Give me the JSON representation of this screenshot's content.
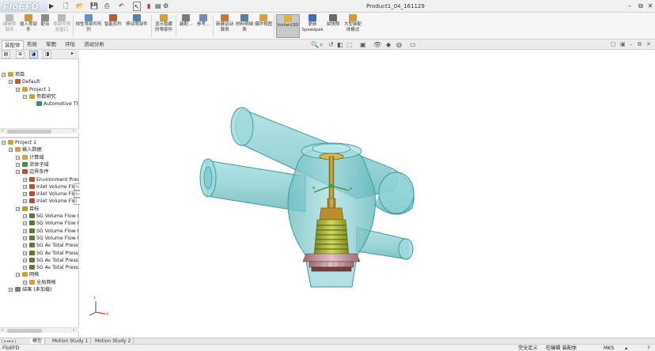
{
  "app": {
    "logo_text": "FloEFD",
    "document_title": "Product1_04_161129",
    "logo_arrow": "▶"
  },
  "window_controls": {
    "minimize": "–",
    "restore": "⧉",
    "close": "✕"
  },
  "ribbon": {
    "buttons": [
      {
        "label": "编辑零部件",
        "dim": true,
        "icon_color": "#b9b9b9"
      },
      {
        "label": "插入零部件",
        "dim": false,
        "icon_color": "#c9973f"
      },
      {
        "label": "配合",
        "dim": false,
        "icon_color": "#8c8c8c"
      },
      {
        "label": "零部件预览窗口",
        "dim": true,
        "icon_color": "#b9b9b9"
      },
      {
        "label": "线性零部件阵列",
        "dim": false,
        "icon_color": "#6a8fbf"
      },
      {
        "label": "智能扣件",
        "dim": false,
        "icon_color": "#a8643f"
      },
      {
        "label": "移动零部件",
        "dim": false,
        "icon_color": "#5f7fa8"
      },
      {
        "label": "显示隐藏的零部件",
        "dim": false,
        "icon_color": "#d0a040"
      },
      {
        "label": "装配...",
        "dim": false,
        "icon_color": "#7a7a7a"
      },
      {
        "label": "参考...",
        "dim": false,
        "icon_color": "#6b8fb5"
      },
      {
        "label": "新建运动算例",
        "dim": false,
        "icon_color": "#c27a3a"
      },
      {
        "label": "材料明细表",
        "dim": false,
        "icon_color": "#5c7da0"
      },
      {
        "label": "爆炸视图",
        "dim": false,
        "icon_color": "#d4a23d"
      },
      {
        "label": "Instant3D",
        "dim": false,
        "icon_color": "#e2b13c",
        "active": true
      },
      {
        "label": "更新 Speedpak",
        "dim": false,
        "icon_color": "#3f6fb0"
      },
      {
        "label": "拍快照",
        "dim": false,
        "icon_color": "#6a6a6a"
      },
      {
        "label": "大型装配体模式",
        "dim": false,
        "icon_color": "#d09a3a"
      }
    ]
  },
  "tabs": [
    "装配体",
    "布局",
    "草图",
    "评估",
    "流动分析"
  ],
  "active_tab": "装配体",
  "tree_top": {
    "items": [
      {
        "label": "项目",
        "indent": 0,
        "icon_color": "#d4a23d"
      },
      {
        "label": "Default",
        "indent": 1,
        "icon_color": "#c65a3a"
      },
      {
        "label": "Project 1",
        "indent": 2,
        "icon_color": "#d4a23d"
      },
      {
        "label": "参数研究",
        "indent": 3,
        "icon_color": "#d4a23d"
      },
      {
        "label": "Automotive Thermostat",
        "indent": 4,
        "icon_color": "#3f8f5a"
      }
    ]
  },
  "tree_bottom": {
    "items": [
      {
        "label": "Project 1",
        "indent": 0,
        "icon_color": "#d4a23d"
      },
      {
        "label": "输入数据",
        "indent": 1,
        "icon_color": "#d4a23d"
      },
      {
        "label": "计算域",
        "indent": 2,
        "icon_color": "#d4a23d"
      },
      {
        "label": "流体子域",
        "indent": 2,
        "icon_color": "#3f8f5a"
      },
      {
        "label": "边界条件",
        "indent": 2,
        "icon_color": "#c24a3a"
      },
      {
        "label": "Environment Pressure",
        "indent": 3,
        "icon_color": "#c24a3a"
      },
      {
        "label": "Inlet Volume Flow (Inlet)",
        "indent": 3,
        "icon_color": "#c24a3a"
      },
      {
        "label": "Inlet Volume Flow (Inlet)",
        "indent": 3,
        "icon_color": "#c24a3a"
      },
      {
        "label": "Inlet Volume Flow (Inlet)",
        "indent": 3,
        "icon_color": "#c24a3a"
      },
      {
        "label": "目标",
        "indent": 2,
        "icon_color": "#b8a030"
      },
      {
        "label": "SG Volume Flow Rate",
        "indent": 3,
        "icon_color": "#5a7a3a"
      },
      {
        "label": "SG Volume Flow Rate",
        "indent": 3,
        "icon_color": "#5a7a3a"
      },
      {
        "label": "SG Volume Flow Rate",
        "indent": 3,
        "icon_color": "#5a7a3a"
      },
      {
        "label": "SG Volume Flow Rate",
        "indent": 3,
        "icon_color": "#5a7a3a"
      },
      {
        "label": "SG Av Total Pressure",
        "indent": 3,
        "icon_color": "#5a7a3a"
      },
      {
        "label": "SG Av Total Pressure",
        "indent": 3,
        "icon_color": "#5a7a3a"
      },
      {
        "label": "SG Av Total Pressure",
        "indent": 3,
        "icon_color": "#5a7a3a"
      },
      {
        "label": "SG Av Total Pressure",
        "indent": 3,
        "icon_color": "#5a7a3a"
      },
      {
        "label": "网格",
        "indent": 2,
        "icon_color": "#d4a23d"
      },
      {
        "label": "全局网格",
        "indent": 3,
        "icon_color": "#d4a23d"
      },
      {
        "label": "结果 (未加载)",
        "indent": 1,
        "icon_color": "#7a7a7a"
      }
    ]
  },
  "tooltip_fragments": [
    "(In",
    "(In",
    "(I"
  ],
  "bottom_tabs": [
    "模型",
    "Motion Study 1",
    "Motion Study 2"
  ],
  "active_bottom_tab": "模型",
  "status": {
    "app": "FloEFD",
    "state": "完全定义",
    "mode": "在编辑 装配体",
    "units": "MKS"
  },
  "hud_icons": [
    "zoom-to-fit-icon",
    "zoom-area-icon",
    "previous-view-icon",
    "section-view-icon",
    "view-orientation-icon",
    "display-style-icon",
    "hide-show-icon",
    "appearance-icon",
    "scene-icon",
    "view-settings-icon"
  ],
  "colors": {
    "fluid_body": "#7fc9cc",
    "fluid_edge": "#3d9a9e",
    "stem": "#c9a230",
    "spring": "#a9b536",
    "seal": "#c9a0a6",
    "seal_dark": "#8a4a4a",
    "ribbon_active": "#c8c8c8"
  }
}
